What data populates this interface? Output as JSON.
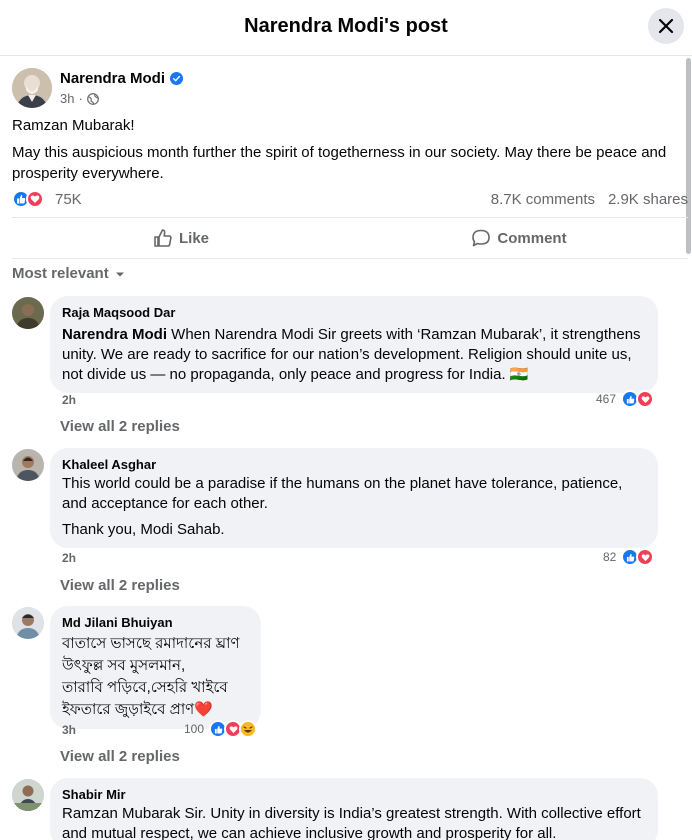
{
  "header": {
    "title": "Narendra Modi's post"
  },
  "post": {
    "author": "Narendra Modi",
    "time": "3h",
    "line1": "Ramzan Mubarak!",
    "line2": "May this auspicious month further the spirit of togetherness in our society. May there be peace and prosperity everywhere.",
    "reactions": "75K",
    "comments": "8.7K comments",
    "shares": "2.9K shares"
  },
  "actions": {
    "like": "Like",
    "comment": "Comment"
  },
  "filter": "Most relevant",
  "comments": [
    {
      "name": "Raja Maqsood Dar",
      "tag": "Narendra Modi",
      "text": " When Narendra Modi Sir greets with ‘Ramzan Mubarak’, it strengthens unity. We are ready to sacrifice for our nation’s development. Religion should unite us, not divide us — no propaganda, only peace and progress for India. 🇮🇳",
      "time": "2h",
      "reacts": "467",
      "replies": "View all 2 replies"
    },
    {
      "name": "Khaleel Asghar",
      "text": "This world could be a paradise if the humans on the planet have tolerance, patience, and acceptance for each other.",
      "text2": "Thank you, Modi Sahab.",
      "time": "2h",
      "reacts": "82",
      "replies": "View all 2 replies"
    },
    {
      "name": "Md Jilani Bhuiyan",
      "text": "বাতাসে ভাসছে রমাদানের ঘ্রাণ\nউৎফুল্ল সব মুসলমান,\nতারাবি পড়িবে,সেহরি খাইবে\nইফতারে জুড়াইবে প্রাণ❤️",
      "time": "3h",
      "reacts": "100",
      "replies": "View all 2 replies"
    },
    {
      "name": "Shabir Mir",
      "text": "Ramzan Mubarak Sir. Unity in diversity is India’s greatest strength. With collective effort and mutual respect, we can achieve inclusive growth and prosperity for all."
    }
  ],
  "icons": {
    "close": "close-icon",
    "verified": "verified-badge-icon",
    "globe": "globe-icon",
    "like": "thumbs-up-icon",
    "love": "heart-icon",
    "haha": "laughing-face-icon",
    "comment": "comment-bubble-icon",
    "dropdown": "caret-down-icon"
  },
  "colors": {
    "like": "#1877f2",
    "love": "#f33e58",
    "muted_text": "#65676b",
    "bubble": "#f0f2f5"
  }
}
